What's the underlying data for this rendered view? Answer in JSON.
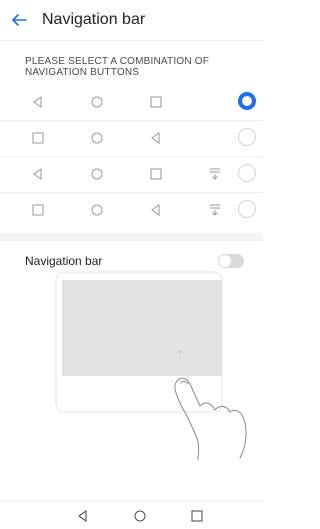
{
  "header": {
    "title": "Navigation bar",
    "back_icon": "arrow-left-icon"
  },
  "section": {
    "label": "PLEASE SELECT A COMBINATION OF NAVIGATION BUTTONS"
  },
  "combinations": [
    {
      "buttons": [
        "back",
        "home",
        "recents"
      ],
      "has_notification": false,
      "selected": true
    },
    {
      "buttons": [
        "recents",
        "home",
        "back"
      ],
      "has_notification": false,
      "selected": false
    },
    {
      "buttons": [
        "back",
        "home",
        "recents"
      ],
      "has_notification": true,
      "selected": false
    },
    {
      "buttons": [
        "recents",
        "home",
        "back"
      ],
      "has_notification": true,
      "selected": false
    }
  ],
  "toggle": {
    "label": "Navigation bar",
    "enabled": false
  },
  "system_nav": [
    "back",
    "home",
    "recents"
  ],
  "colors": {
    "accent": "#1e6fe8",
    "icon_gray": "#9a9a9a"
  }
}
